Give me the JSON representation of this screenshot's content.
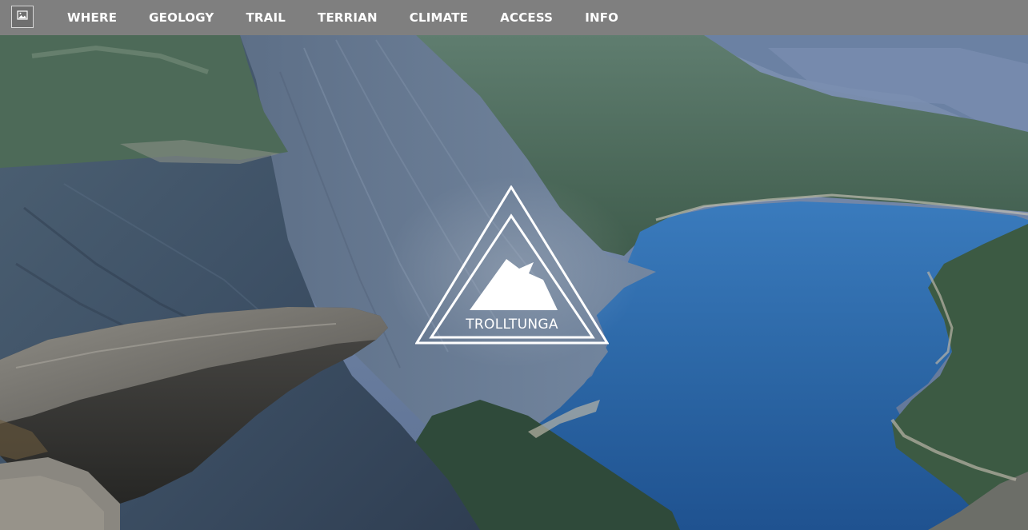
{
  "nav": {
    "logo_icon": "image-icon",
    "items": [
      {
        "label": "WHERE"
      },
      {
        "label": "GEOLOGY"
      },
      {
        "label": "TRAIL"
      },
      {
        "label": "TERRIAN"
      },
      {
        "label": "CLIMATE"
      },
      {
        "label": "ACCESS"
      },
      {
        "label": "INFO"
      }
    ]
  },
  "hero": {
    "brand_name": "TROLLTUNGA",
    "brand_icon": "mountain-triangle-logo",
    "background": "fjord-landscape-photo"
  },
  "colors": {
    "navbar_bg": "#7f7f7f",
    "nav_text": "#ffffff",
    "lake": "#2b6aa8",
    "cliffs": "#4a5c73"
  }
}
